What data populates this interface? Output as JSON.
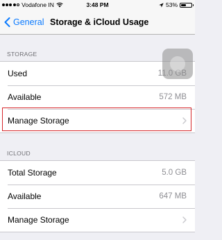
{
  "status_bar": {
    "carrier": "Vodafone IN",
    "time": "3:48 PM",
    "battery": "53%",
    "battery_level": 0.53,
    "signal_bars": 4,
    "icons": [
      "signal-dots",
      "wifi-icon",
      "location-icon",
      "battery-icon"
    ]
  },
  "nav": {
    "back_label": "General",
    "title": "Storage & iCloud Usage"
  },
  "storage": {
    "header": "STORAGE",
    "rows": [
      {
        "label": "Used",
        "value": "11.0 GB"
      },
      {
        "label": "Available",
        "value": "572 MB"
      },
      {
        "label": "Manage Storage",
        "value": ""
      }
    ]
  },
  "icloud": {
    "header": "ICLOUD",
    "rows": [
      {
        "label": "Total Storage",
        "value": "5.0 GB"
      },
      {
        "label": "Available",
        "value": "647 MB"
      },
      {
        "label": "Manage Storage",
        "value": ""
      }
    ]
  },
  "colors": {
    "accent": "#0a7aff",
    "highlight": "#d6262b",
    "background": "#efeff4"
  }
}
